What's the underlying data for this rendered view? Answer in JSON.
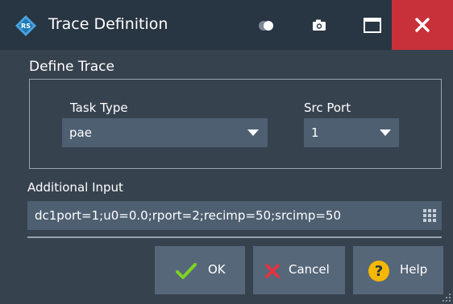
{
  "window": {
    "title": "Trace Definition"
  },
  "define_trace": {
    "section_title": "Define Trace",
    "task_type": {
      "label": "Task Type",
      "value": "pae"
    },
    "src_port": {
      "label": "Src Port",
      "value": "1"
    }
  },
  "additional_input": {
    "label": "Additional Input",
    "value": "dc1port=1;u0=0.0;rport=2;recimp=50;srcimp=50"
  },
  "buttons": {
    "ok": "OK",
    "cancel": "Cancel",
    "help": "Help"
  },
  "colors": {
    "title_bar": "#283542",
    "background": "#37424f",
    "field": "#4e5f71",
    "button": "#56677a",
    "close": "#c8313a",
    "ok_check": "#7ed321",
    "cancel_x": "#e8303b",
    "help_icon": "#f5b800",
    "logo": "#4aa3df"
  },
  "icons": {
    "logo": "rs-logo-icon",
    "toggle": "transparency-toggle-icon",
    "camera": "camera-icon",
    "maximize": "maximize-icon",
    "close": "close-icon",
    "keyboard": "keyboard-icon",
    "ok": "checkmark-icon",
    "cancel": "x-icon",
    "help": "question-icon"
  }
}
